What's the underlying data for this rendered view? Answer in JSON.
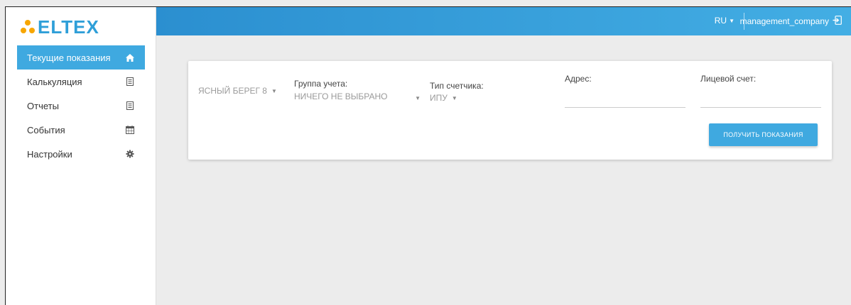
{
  "brand": {
    "logo_text": "ELTEX",
    "accent": "#3fa9e0"
  },
  "sidebar": {
    "items": [
      {
        "label": "Текущие показания",
        "icon": "home-icon",
        "active": true
      },
      {
        "label": "Калькуляция",
        "icon": "document-icon",
        "active": false
      },
      {
        "label": "Отчеты",
        "icon": "document-icon",
        "active": false
      },
      {
        "label": "События",
        "icon": "calendar-icon",
        "active": false
      },
      {
        "label": "Настройки",
        "icon": "gear-icon",
        "active": false
      }
    ]
  },
  "topbar": {
    "language": "RU",
    "username": "management_company",
    "logout_icon": "logout-icon"
  },
  "filters": {
    "complex": {
      "value": "ЯСНЫЙ БЕРЕГ 8"
    },
    "group": {
      "label": "Группа учета:",
      "value": "НИЧЕГО НЕ ВЫБРАНО"
    },
    "meter_type": {
      "label": "Тип счетчика:",
      "value": "ИПУ"
    },
    "address": {
      "label": "Адрес:",
      "value": ""
    },
    "account": {
      "label": "Лицевой счет:",
      "value": ""
    }
  },
  "actions": {
    "get_readings_label": "ПОЛУЧИТЬ ПОКАЗАНИЯ"
  }
}
